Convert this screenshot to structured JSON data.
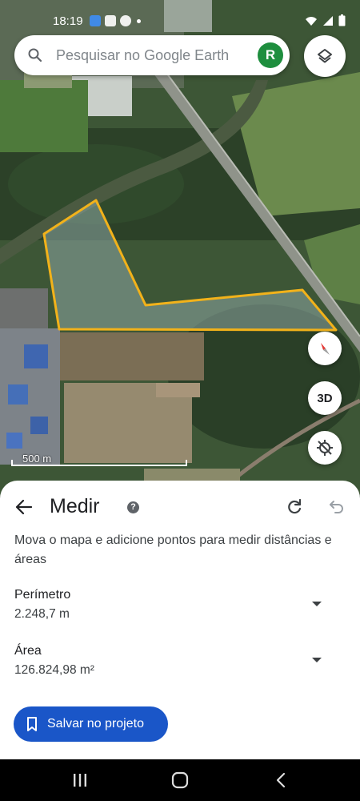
{
  "status_bar": {
    "time": "18:19"
  },
  "search": {
    "placeholder": "Pesquisar no Google Earth",
    "avatar_letter": "R"
  },
  "map": {
    "fab_3d_label": "3D",
    "scale_label": "500 m",
    "polygon_color": "#f2b21a"
  },
  "sheet": {
    "title": "Medir",
    "help_symbol": "?",
    "instructions": "Mova o mapa e adicione pontos para medir distâncias e áreas",
    "perimeter": {
      "label": "Perímetro",
      "value": "2.248,7 m"
    },
    "area": {
      "label": "Área",
      "value": "126.824,98 m²"
    },
    "save_label": "Salvar no projeto"
  },
  "colors": {
    "accent": "#1a56c8",
    "avatar": "#1e8e3e"
  },
  "icons": {
    "search": "search-icon",
    "layers": "layers-icon",
    "compass": "compass-icon",
    "recenter": "location-off-icon",
    "back": "arrow-back-icon",
    "help": "help-icon",
    "redo": "redo-icon",
    "undo": "undo-icon",
    "bookmark": "bookmark-icon",
    "nav_recents": "recents-icon",
    "nav_home": "home-icon",
    "nav_back": "back-icon"
  }
}
